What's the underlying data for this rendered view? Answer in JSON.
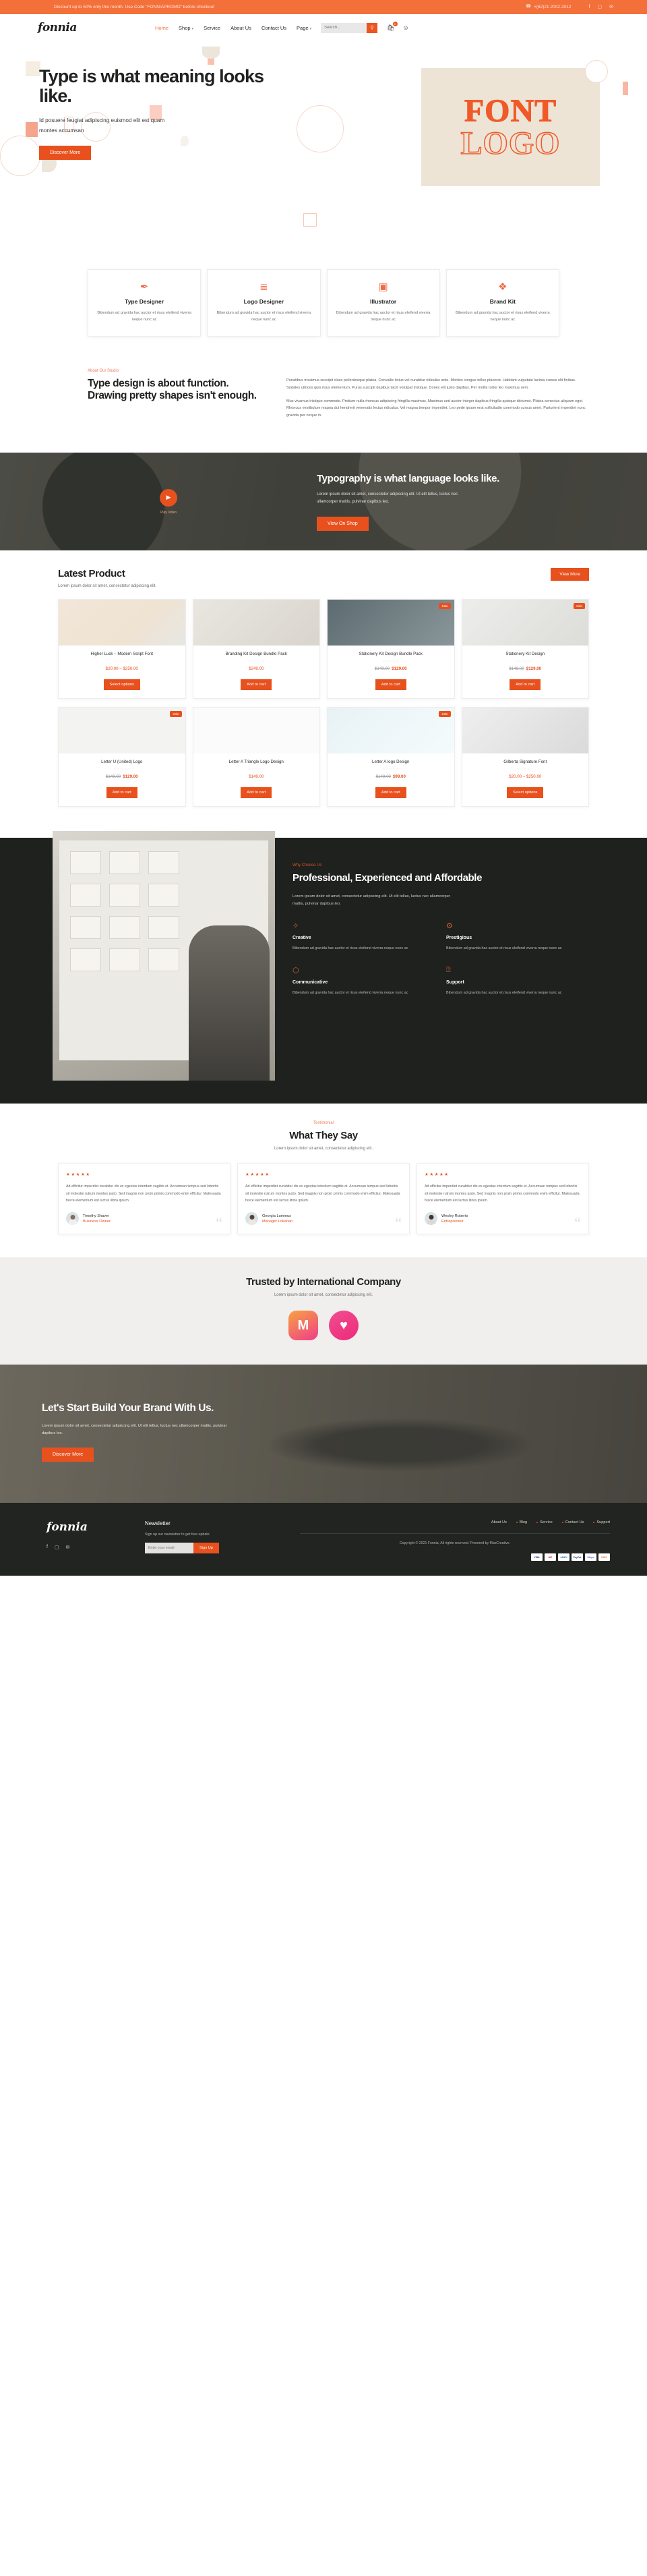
{
  "topbar": {
    "promo": "Discount up to 50% only this month. Use Code \"FONNIAPROMO\" before checkout",
    "phone": "+(62)21 2002-2012",
    "phone_icon": "phone-icon",
    "social": [
      {
        "name": "facebook-icon",
        "glyph": "f"
      },
      {
        "name": "instagram-icon",
        "glyph": "▢"
      },
      {
        "name": "twitter-icon",
        "glyph": "✉"
      }
    ]
  },
  "header": {
    "logo": "fonnia",
    "nav": [
      {
        "label": "Home",
        "active": true,
        "caret": ""
      },
      {
        "label": "Shop",
        "active": false,
        "caret": "▾"
      },
      {
        "label": "Service",
        "active": false,
        "caret": ""
      },
      {
        "label": "About Us",
        "active": false,
        "caret": ""
      },
      {
        "label": "Contact Us",
        "active": false,
        "caret": ""
      },
      {
        "label": "Page",
        "active": false,
        "caret": "▾"
      }
    ],
    "search_placeholder": "Search...",
    "search_value": "",
    "search_icon": "search-icon",
    "cart_icon": "cart-icon",
    "cart_count": "0",
    "account_icon": "user-icon"
  },
  "hero": {
    "heading": "Type is what meaning looks like.",
    "sub": "Id posuere feugiat adipiscing euismod elit est quam montes accumsan",
    "cta": "Discover More",
    "art_line1": "FONT",
    "art_line2": "LOGO"
  },
  "features": [
    {
      "icon": "pen-nib-icon",
      "glyph": "✒",
      "title": "Type Designer",
      "text": "Bibendum ad gravida hac auctor et risus eleifend viverra neque nunc ac"
    },
    {
      "icon": "layers-icon",
      "glyph": "≣",
      "title": "Logo Designer",
      "text": "Bibendum ad gravida hac auctor et risus eleifend viverra neque nunc ac"
    },
    {
      "icon": "image-icon",
      "glyph": "▣",
      "title": "Illustrator",
      "text": "Bibendum ad gravida hac auctor et risus eleifend viverra neque nunc ac"
    },
    {
      "icon": "palette-icon",
      "glyph": "❖",
      "title": "Brand Kit",
      "text": "Bibendum ad gravida hac auctor et risus eleifend viverra neque nunc ac"
    }
  ],
  "about": {
    "eyebrow": "About Our Studio",
    "heading": "Type design is about function. Drawing pretty shapes isn't enough.",
    "p1": "Penatibus maximus suscipit class pellentesque platea. Convallis letius vel curabitur ridiculus ante. Montes congue tellus placerat. Habitant vulputate lacinia cursus elit finibus. Sodales ultrices quis risus elementum. Purus suscipit dapibus taciti volutpat tristique. Donec elit justo dapibus. Per mollis tortor leo maximus sem.",
    "p2": "Mus vivamus tristique commodo. Pretium nulla rhoncus adipiscing fringilla maximus. Maximus sed auctor integer dapibus fringilla quisque dictumst. Platea senectus aliquam eget. Rhoncus vestibulum magna dui hendrerit venenatis lectus ridiculus. Vel magna tempor imperdiet. Leo pede ipsum erat sollicitudin commodo cursus amet. Parturient imperdiet nunc gravida per neque in."
  },
  "videoband": {
    "play_icon": "play-icon",
    "play_glyph": "▶",
    "play_label": "Play Video",
    "heading": "Typography is what language looks like.",
    "text": "Lorem ipsum dolor sit amet, consectetur adipiscing elit. Ut elit tellus, luctus nec ullamcorper mattis, pulvinar dapibus leo.",
    "cta": "View On Shop"
  },
  "products": {
    "title": "Latest Product",
    "subtitle": "Lorem ipsum dolor sit amet, consectetur adipiscing elit.",
    "view_more": "View More",
    "stars": "☆☆☆☆☆",
    "row1": [
      {
        "name": "Higher Luck – Modern Script Font",
        "price": "$20.00 – $250.00",
        "old": "",
        "new": "",
        "cta": "Select options",
        "sale": false
      },
      {
        "name": "Branding Kit Design Bundle Pack",
        "price": "$249.00",
        "old": "",
        "new": "",
        "cta": "Add to cart",
        "sale": false
      },
      {
        "name": "Stationery Kit Design Bundle Pack",
        "price": "",
        "old": "$149.00",
        "new": "$129.00",
        "cta": "Add to cart",
        "sale": true
      },
      {
        "name": "Stationery Kit Design",
        "price": "",
        "old": "$149.00",
        "new": "$129.00",
        "cta": "Add to cart",
        "sale": true
      }
    ],
    "row2": [
      {
        "name": "Letter U (United) Logo",
        "price": "",
        "old": "$149.00",
        "new": "$129.00",
        "cta": "Add to cart",
        "sale": true
      },
      {
        "name": "Letter A Triangle Logo Design",
        "price": "$149.00",
        "old": "",
        "new": "",
        "cta": "Add to cart",
        "sale": false
      },
      {
        "name": "Letter A logo Design",
        "price": "",
        "old": "$149.00",
        "new": "$99.00",
        "cta": "Add to cart",
        "sale": true
      },
      {
        "name": "Gilberta Signature Font",
        "price": "$20.00 – $250.00",
        "old": "",
        "new": "",
        "cta": "Select options",
        "sale": false
      }
    ],
    "sale_label": "Sale"
  },
  "why": {
    "eyebrow": "Why Choose Us",
    "heading": "Professional, Experienced and Affordable",
    "text": "Lorem ipsum dolor sit amet, consectetur adipiscing elit. Ut elit tellus, luctus nec ullamcorper mattis, pulvinar dapibus leo.",
    "items": [
      {
        "icon": "lightbulb-icon",
        "glyph": "✧",
        "title": "Creative",
        "text": "Bibendum ad gravida hac auctor et risus eleifend viverra neque nunc ac"
      },
      {
        "icon": "medal-icon",
        "glyph": "⚙",
        "title": "Prestigious",
        "text": "Bibendum ad gravida hac auctor et risus eleifend viverra neque nunc ac"
      },
      {
        "icon": "cube-icon",
        "glyph": "⬡",
        "title": "Communicative",
        "text": "Bibendum ad gravida hac auctor et risus eleifend viverra neque nunc ac"
      },
      {
        "icon": "chat-help-icon",
        "glyph": "⍰",
        "title": "Support",
        "text": "Bibendum ad gravida hac auctor et risus eleifend viverra neque nunc ac"
      }
    ]
  },
  "testimonial": {
    "eyebrow": "Testimonial",
    "title": "What They Say",
    "subtitle": "Lorem ipsum dolor sit amet, consectetur adipiscing elit.",
    "stars": "★★★★★",
    "quote_glyph": "“",
    "items": [
      {
        "text": "Ad efficitur imperdiet curabitur dis ex egestas interdum sagittis et. Accumsan tempus sed lobortis sit molestie rutrum montes justo. Sed magnis non proin primis commodo enim efficitur. Malesuada fusce elementum est luctus litora ipsum.",
        "name": "Timothy Shaver",
        "role": "Business Owner"
      },
      {
        "text": "Ad efficitur imperdiet curabitur dis ex egestas interdum sagittis et. Accumsan tempus sed lobortis sit molestie rutrum montes justo. Sed magnis non proin primis commodo enim efficitur. Malesuada fusce elementum est luctus litora ipsum.",
        "name": "Georgia Lummus",
        "role": "Manager Lokanan"
      },
      {
        "text": "Ad efficitur imperdiet curabitur dis ex egestas interdum sagittis et. Accumsan tempus sed lobortis sit molestie rutrum montes justo. Sed magnis non proin primis commodo enim efficitur. Malesuada fusce elementum est luctus litora ipsum.",
        "name": "Wesley Roberts",
        "role": "Entrepreneur"
      }
    ]
  },
  "trusted": {
    "title": "Trusted by International Company",
    "subtitle": "Lorem ipsum dolor sit amet, consectetur adipiscing elit.",
    "brands": [
      {
        "name": "brand-logo-m",
        "glyph": "M"
      },
      {
        "name": "brand-logo-heart",
        "glyph": "♥"
      }
    ]
  },
  "cta": {
    "heading": "Let's Start Build Your Brand With Us.",
    "text": "Lorem ipsum dolor sit amet, consectetur adipiscing elit. Ut elit tellus, luctus nec ullamcorper mattis, pulvinar dapibus leo.",
    "button": "Discover More"
  },
  "footer": {
    "logo": "fonnia",
    "social": [
      {
        "name": "facebook-icon",
        "glyph": "f"
      },
      {
        "name": "instagram-icon",
        "glyph": "▢"
      },
      {
        "name": "twitter-icon",
        "glyph": "✉"
      }
    ],
    "newsletter_title": "Newsletter",
    "newsletter_text": "Sign up our newsletter to get free update",
    "email_placeholder": "Enter your email",
    "email_value": "",
    "signup": "Sign Up",
    "links": [
      "About Us",
      "Blog",
      "Service",
      "Contact Us",
      "Support"
    ],
    "copyright": "Copyright © 2021 Fonnia, All rights reserved. Powered by MaxCreative.",
    "payments": [
      "VISA",
      "MC",
      "AMEX",
      "PayPal",
      "Stripe",
      "DISC"
    ]
  },
  "colors": {
    "accent": "#e8511e",
    "accent_light": "#f4703a",
    "dark": "#1e211e",
    "cream": "#ede4d6"
  }
}
